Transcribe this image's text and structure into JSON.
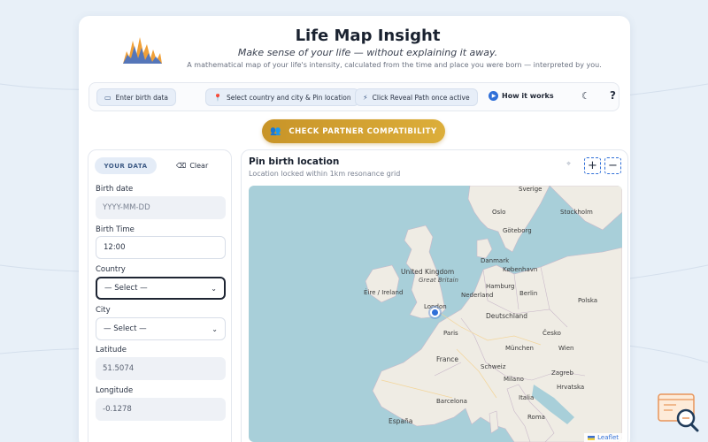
{
  "header": {
    "title": "Life Map Insight",
    "tagline": "Make sense of your life — without explaining it away.",
    "subtitle": "A mathematical map of your life's intensity, calculated from the time and place you were born — interpreted by you."
  },
  "steps": {
    "items": [
      {
        "icon": "calendar-icon",
        "label": "Enter birth data"
      },
      {
        "icon": "pin-icon",
        "label": "Select country and city & Pin location"
      },
      {
        "icon": "bolt-icon",
        "label": "Click Reveal Path once active"
      }
    ],
    "how_label": "How it works",
    "help_label": "?"
  },
  "partner_button": "CHECK PARTNER COMPATIBILITY",
  "form": {
    "tab_active": "YOUR DATA",
    "tab_clear": "Clear",
    "birth_date_label": "Birth date",
    "birth_date_placeholder": "YYYY-MM-DD",
    "birth_time_label": "Birth Time",
    "birth_time_value": "12:00",
    "country_label": "Country",
    "country_value": "— Select —",
    "city_label": "City",
    "city_value": "— Select —",
    "latitude_label": "Latitude",
    "latitude_value": "51.5074",
    "longitude_label": "Longitude",
    "longitude_value": "-0.1278"
  },
  "map": {
    "title": "Pin birth location",
    "subtitle": "Location locked within 1km resonance grid",
    "zoom_in": "+",
    "zoom_out": "−",
    "attribution": "Leaflet",
    "labels": {
      "sverige": "Sverige",
      "oslo": "Oslo",
      "stockholm": "Stockholm",
      "goteborg": "Göteborg",
      "danmark": "Danmark",
      "kobenhavn": "København",
      "uk": "United Kingdom",
      "great_britain": "Great Britain",
      "eire": "Éire / Ireland",
      "nederland": "Nederland",
      "hamburg": "Hamburg",
      "london": "London",
      "berlin": "Berlin",
      "polska": "Polska",
      "deutschland": "Deutschland",
      "paris": "Paris",
      "cesko": "Česko",
      "munchen": "München",
      "wien": "Wien",
      "france": "France",
      "schweiz": "Schweiz",
      "milano": "Milano",
      "zagreb": "Zagreb",
      "hrvatska": "Hrvatska",
      "italia": "Italia",
      "roma": "Roma",
      "barcelona": "Barcelona",
      "espana": "España"
    }
  },
  "colors": {
    "accent": "#2f6fd8",
    "gold": "#d4a333",
    "sea": "#a8cfd9",
    "land": "#efece4"
  }
}
